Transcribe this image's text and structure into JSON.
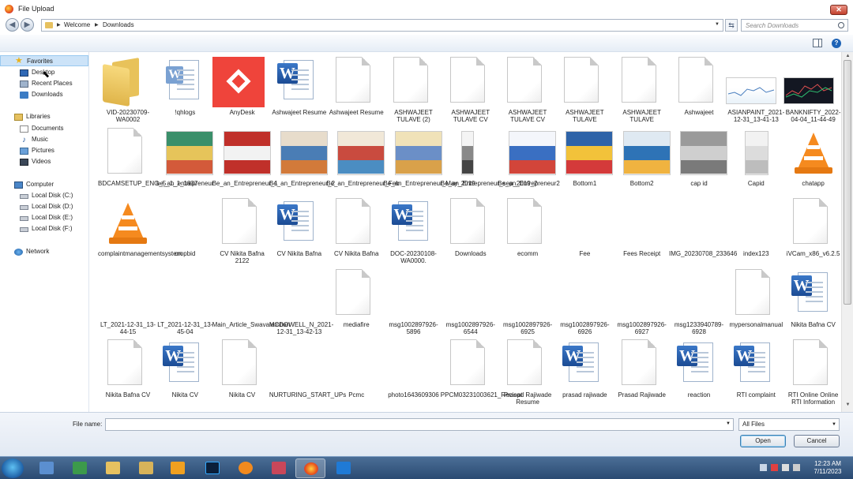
{
  "window": {
    "title": "File Upload",
    "close_label": "✕"
  },
  "nav": {
    "breadcrumbs": [
      "Welcome",
      "Downloads"
    ],
    "search_placeholder": "Search Downloads"
  },
  "sidebar": {
    "favorites": {
      "label": "Favorites",
      "items": [
        "Desktop",
        "Recent Places",
        "Downloads"
      ]
    },
    "libraries": {
      "label": "Libraries",
      "items": [
        "Documents",
        "Music",
        "Pictures",
        "Videos"
      ]
    },
    "computer": {
      "label": "Computer",
      "items": [
        "Local Disk (C:)",
        "Local Disk (D:)",
        "Local Disk (E:)",
        "Local Disk (F:)"
      ]
    },
    "network": {
      "label": "Network"
    }
  },
  "files": [
    [
      {
        "name": "VID-20230709-WA0002",
        "kind": "folder"
      },
      {
        "name": "!qhlogs",
        "kind": "word-doc"
      },
      {
        "name": "AnyDesk",
        "kind": "anydesk"
      },
      {
        "name": "Ashwajeet Resume",
        "kind": "word"
      },
      {
        "name": "Ashwajeet Resume",
        "kind": "generic"
      },
      {
        "name": "ASHWAJEET TULAVE (2)",
        "kind": "generic"
      },
      {
        "name": "ASHWAJEET TULAVE CV",
        "kind": "generic"
      },
      {
        "name": "ASHWAJEET TULAVE CV",
        "kind": "generic"
      },
      {
        "name": "ASHWAJEET TULAVE",
        "kind": "generic"
      },
      {
        "name": "ASHWAJEET TULAVE",
        "kind": "generic"
      },
      {
        "name": "Ashwajeet",
        "kind": "generic"
      },
      {
        "name": "ASIANPAINT_2021-12-31_13-41-13",
        "kind": "chart-light"
      },
      {
        "name": "BANKNIFTY_2022-04-04_11-44-49",
        "kind": "chart-dark"
      }
    ],
    [
      {
        "name": "BDCAMSETUP_ENG_5_1_1_1837",
        "kind": "generic"
      },
      {
        "name": "be_an_entrepreneur",
        "kind": "photo-green"
      },
      {
        "name": "Be_an_Entrepreneur_1",
        "kind": "photo-red"
      },
      {
        "name": "Be_an_Entrepreneur_2",
        "kind": "photo-info"
      },
      {
        "name": "Be_an_Entrepreneur_Feb",
        "kind": "photo-info2"
      },
      {
        "name": "Be_an_Entrepreneur_May_2019",
        "kind": "photo-beige"
      },
      {
        "name": "Be_an_Entrepreneur_sep_2019_2",
        "kind": "photo-tall"
      },
      {
        "name": "Be_an_Entrepreneur2",
        "kind": "photo-blue"
      },
      {
        "name": "Bottom1",
        "kind": "photo-poster"
      },
      {
        "name": "Bottom2",
        "kind": "photo-map"
      },
      {
        "name": "cap id",
        "kind": "photo-gray"
      },
      {
        "name": "Capid",
        "kind": "photo-phone"
      },
      {
        "name": "chatapp",
        "kind": "vlc"
      }
    ],
    [
      {
        "name": "complaintmanagementsystem",
        "kind": "vlc"
      },
      {
        "name": "cropbid",
        "kind": "none"
      },
      {
        "name": "CV Nikita Bafna 2122",
        "kind": "generic"
      },
      {
        "name": "CV Nikita Bafna",
        "kind": "word"
      },
      {
        "name": "CV Nikita Bafna",
        "kind": "generic"
      },
      {
        "name": "DOC-20230108-WA0000.",
        "kind": "word"
      },
      {
        "name": "Downloads",
        "kind": "generic"
      },
      {
        "name": "ecomm",
        "kind": "generic"
      },
      {
        "name": "Fee",
        "kind": "none"
      },
      {
        "name": "Fees Receipt",
        "kind": "none"
      },
      {
        "name": "IMG_20230708_233646",
        "kind": "none"
      },
      {
        "name": "index123",
        "kind": "none"
      },
      {
        "name": "iVCam_x86_v6.2.5",
        "kind": "generic"
      }
    ],
    [
      {
        "name": "LT_2021-12-31_13-44-15",
        "kind": "none"
      },
      {
        "name": "LT_2021-12-31_13-45-04",
        "kind": "none"
      },
      {
        "name": "Main_Article_Swavalamban",
        "kind": "none"
      },
      {
        "name": "MCDOWELL_N_2021-12-31_13-42-13",
        "kind": "none"
      },
      {
        "name": "mediafire",
        "kind": "generic"
      },
      {
        "name": "msg1002897926-5896",
        "kind": "none"
      },
      {
        "name": "msg1002897926-6544",
        "kind": "none"
      },
      {
        "name": "msg1002897926-6925",
        "kind": "none"
      },
      {
        "name": "msg1002897926-6926",
        "kind": "none"
      },
      {
        "name": "msg1002897926-6927",
        "kind": "none"
      },
      {
        "name": "msg1233940789-6928",
        "kind": "none"
      },
      {
        "name": "mypersonalmanual",
        "kind": "generic"
      },
      {
        "name": "Nikita Bafna CV",
        "kind": "word"
      }
    ],
    [
      {
        "name": "Nikita Bafna CV",
        "kind": "generic"
      },
      {
        "name": "Nikita CV",
        "kind": "word"
      },
      {
        "name": "Nikita CV",
        "kind": "generic"
      },
      {
        "name": "NURTURING_START_UPs",
        "kind": "none"
      },
      {
        "name": "Pcmc",
        "kind": "none"
      },
      {
        "name": "photo1643609306",
        "kind": "none"
      },
      {
        "name": "PPCM03231003621_Reciept",
        "kind": "generic"
      },
      {
        "name": "Prasad Rajiwade Resume",
        "kind": "generic"
      },
      {
        "name": "prasad rajiwade",
        "kind": "word"
      },
      {
        "name": "Prasad Rajiwade",
        "kind": "generic"
      },
      {
        "name": "reaction",
        "kind": "word"
      },
      {
        "name": "RTI complaint",
        "kind": "word"
      },
      {
        "name": "RTI Online Online RTI Information",
        "kind": "generic"
      }
    ]
  ],
  "footer": {
    "filename_label": "File name:",
    "filename_value": "",
    "filter_value": "All Files",
    "open_label": "Open",
    "cancel_label": "Cancel"
  },
  "taskbar": {
    "time": "12:23 AM",
    "date": "7/11/2023",
    "apps": [
      "control-panel-icon",
      "network-manager-icon",
      "file-explorer-icon",
      "file-manager-icon",
      "media-player-icon",
      "photoshop-icon",
      "fl-studio-icon",
      "snipping-tool-icon",
      "firefox-icon",
      "vscode-icon"
    ]
  },
  "colors": {
    "accent": "#cce3f8",
    "taskbar": "#2a4a72",
    "anydesk": "#ef443b",
    "vlc": "#f58a1f",
    "word": "#1b4b94"
  }
}
